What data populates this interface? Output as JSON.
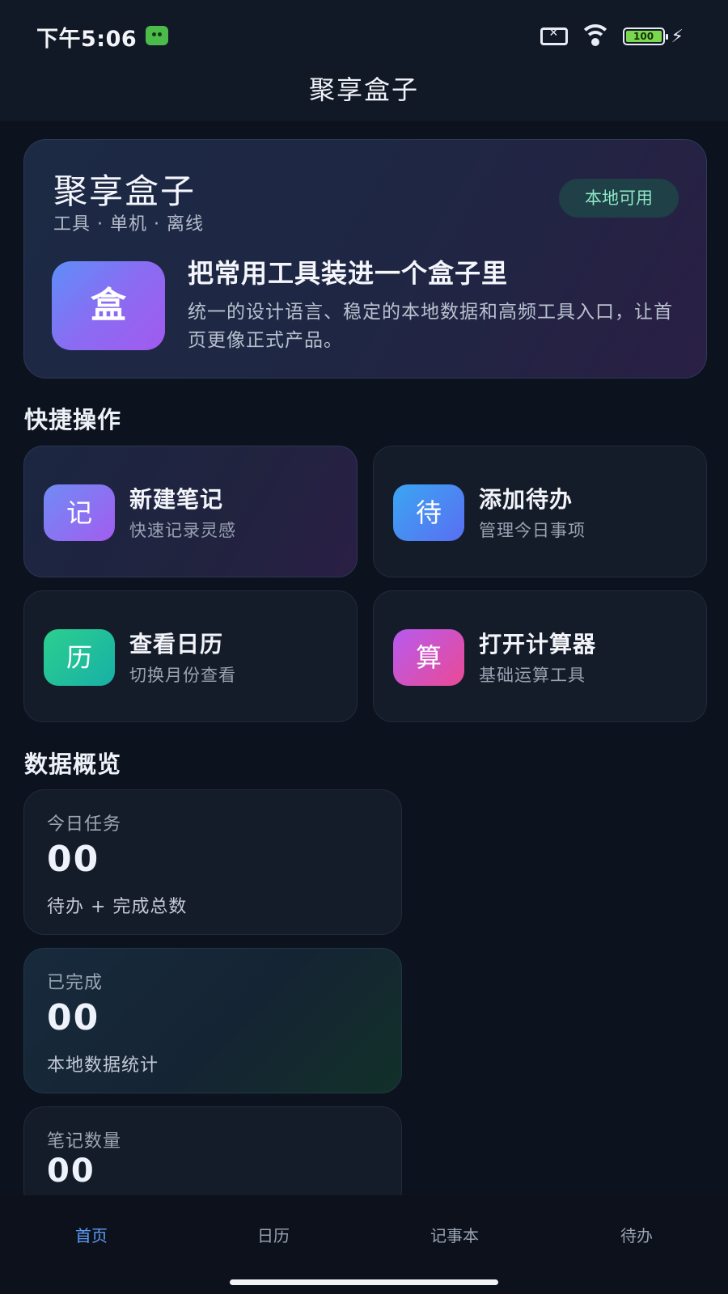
{
  "status_bar": {
    "time": "下午5:06",
    "battery": "100",
    "icons": [
      "app-notification-icon",
      "sim-off-icon",
      "wifi-icon",
      "battery-icon",
      "charging-bolt-icon"
    ]
  },
  "app_bar": {
    "title": "聚享盒子"
  },
  "hero": {
    "title": "聚享盒子",
    "subtitle": "工具 · 单机 · 离线",
    "badge": "本地可用",
    "logo_char": "盒",
    "headline": "把常用工具装进一个盒子里",
    "description": "统一的设计语言、稳定的本地数据和高频工具入口，让首页更像正式产品。"
  },
  "quick_actions": {
    "title": "快捷操作",
    "items": [
      {
        "icon": "记",
        "label": "新建笔记",
        "desc": "快速记录灵感",
        "color_from": "#6f8cf4",
        "color_to": "#a35cf0"
      },
      {
        "icon": "待",
        "label": "添加待办",
        "desc": "管理今日事项",
        "color_from": "#3aa6f2",
        "color_to": "#5a6ef2"
      },
      {
        "icon": "历",
        "label": "查看日历",
        "desc": "切换月份查看",
        "color_from": "#2ccf8f",
        "color_to": "#18b0a6"
      },
      {
        "icon": "算",
        "label": "打开计算器",
        "desc": "基础运算工具",
        "color_from": "#b75af0",
        "color_to": "#ea4a94"
      }
    ]
  },
  "overview": {
    "title": "数据概览",
    "stats": [
      {
        "label": "今日任务",
        "value": "00",
        "note": "待办 + 完成总数"
      },
      {
        "label": "已完成",
        "value": "00",
        "note": "本地数据统计"
      },
      {
        "label": "笔记数量",
        "value": "00",
        "note": ""
      }
    ]
  },
  "bottom_nav": {
    "items": [
      {
        "label": "首页",
        "active": true
      },
      {
        "label": "日历",
        "active": false
      },
      {
        "label": "记事本",
        "active": false
      },
      {
        "label": "待办",
        "active": false
      }
    ]
  },
  "colors": {
    "background": "#0c121e",
    "accent": "#5e9cf7",
    "badge_text": "#8ee6c4"
  }
}
